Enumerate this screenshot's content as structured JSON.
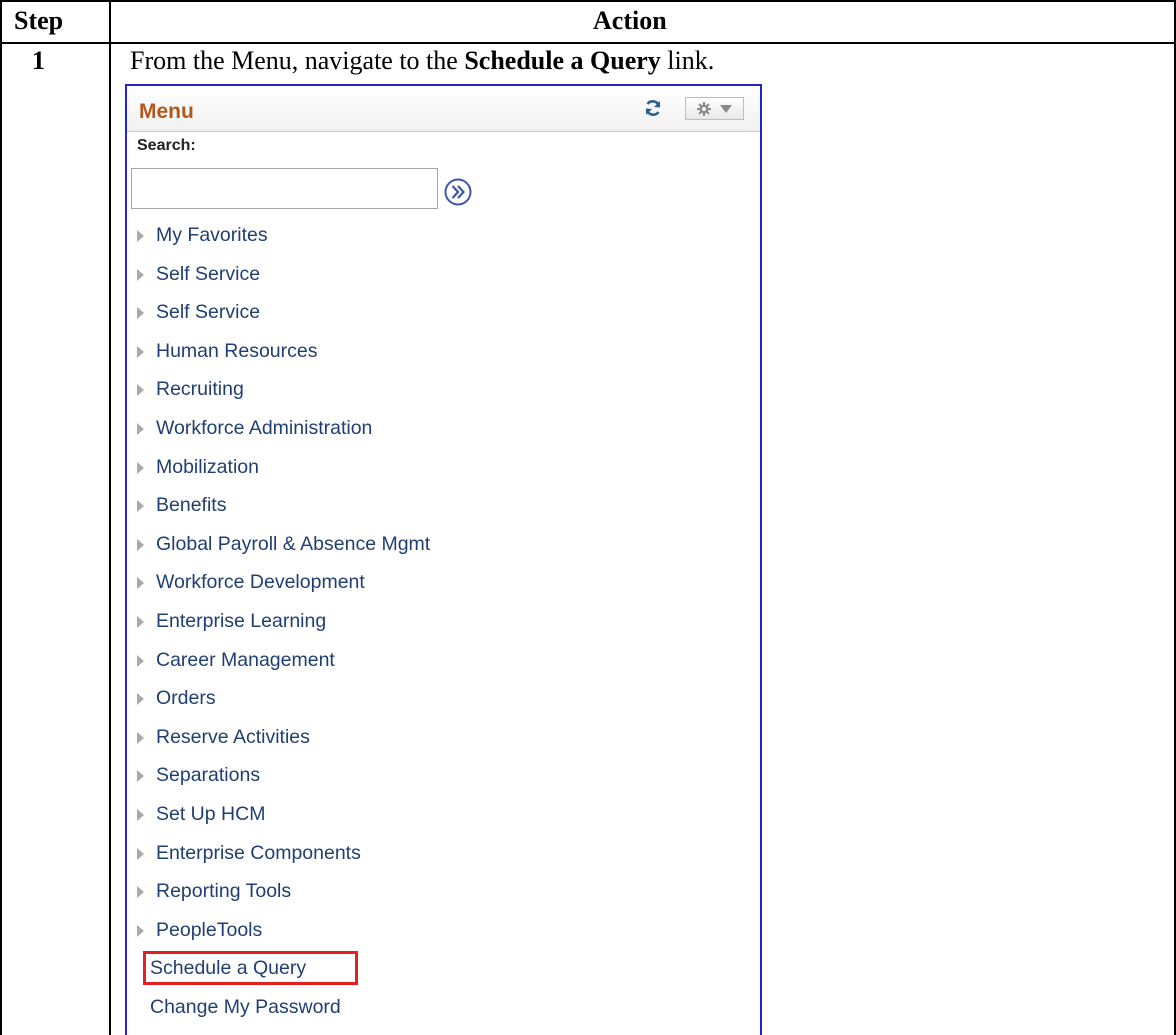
{
  "table": {
    "header_step": "Step",
    "header_action": "Action",
    "step_number": "1",
    "instruction_prefix": "From the Menu, navigate to the ",
    "instruction_bold": "Schedule a Query",
    "instruction_suffix": " link."
  },
  "menu": {
    "title": "Menu",
    "search_label": "Search:",
    "search_value": "",
    "icons": {
      "refresh": "refresh-icon",
      "settings": "gear-icon",
      "dropdown": "chevron-down-icon",
      "search_go": "double-chevron-right-icon",
      "expand": "triangle-right-icon"
    },
    "folders": [
      "My Favorites",
      "Self Service",
      "Self Service",
      "Human Resources",
      "Recruiting",
      "Workforce Administration",
      "Mobilization",
      "Benefits",
      "Global Payroll & Absence Mgmt",
      "Workforce Development",
      "Enterprise Learning",
      "Career Management",
      "Orders",
      "Reserve Activities",
      "Separations",
      "Set Up HCM",
      "Enterprise Components",
      "Reporting Tools",
      "PeopleTools"
    ],
    "links": [
      {
        "label": "Schedule a Query",
        "highlighted": true
      },
      {
        "label": "Change My Password",
        "highlighted": false
      }
    ],
    "colors": {
      "title": "#b2581b",
      "item_text": "#1f3f72",
      "panel_border": "#2323c8",
      "highlight": "#e52020"
    }
  }
}
